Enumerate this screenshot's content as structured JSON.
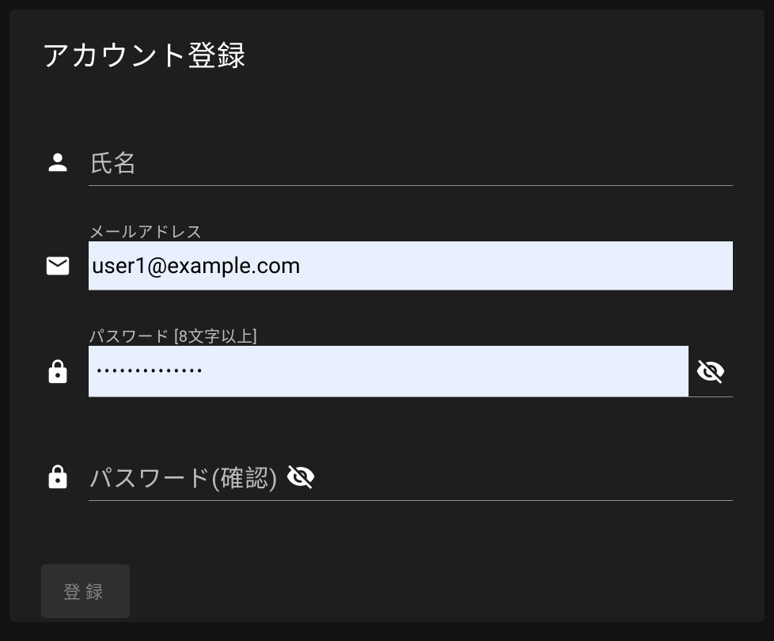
{
  "title": "アカウント登録",
  "fields": {
    "name": {
      "label": "氏名",
      "value": ""
    },
    "email": {
      "label": "メールアドレス",
      "value": "user1@example.com"
    },
    "password": {
      "label": "パスワード [8文字以上]",
      "value_mask": "••••••••••••••"
    },
    "password_confirm": {
      "label": "パスワード(確認)",
      "value": ""
    }
  },
  "submit_label": "登録"
}
